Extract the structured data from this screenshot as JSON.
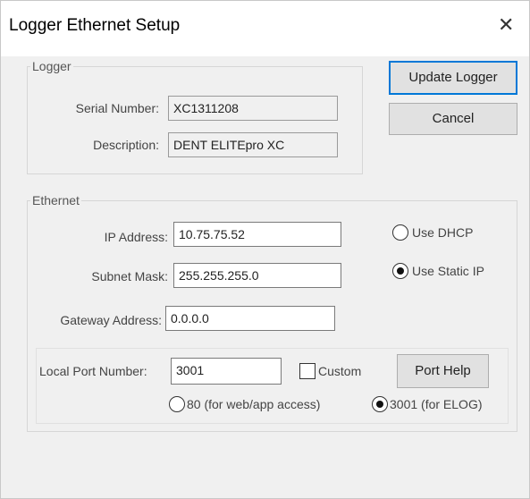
{
  "window": {
    "title": "Logger Ethernet Setup",
    "close_glyph": "✕"
  },
  "logger": {
    "group_label": "Logger",
    "serial_label": "Serial Number:",
    "serial_value": "XC1311208",
    "description_label": "Description:",
    "description_value": "DENT ELITEpro XC"
  },
  "buttons": {
    "update": "Update Logger",
    "cancel": "Cancel",
    "port_help": "Port Help"
  },
  "ethernet": {
    "group_label": "Ethernet",
    "ip_label": "IP Address:",
    "ip_value": "10.75.75.52",
    "subnet_label": "Subnet Mask:",
    "subnet_value": "255.255.255.0",
    "gateway_label": "Gateway Address:",
    "gateway_value": "0.0.0.0",
    "dhcp_label": "Use DHCP",
    "static_label": "Use Static IP",
    "selected_mode": "Use Static IP"
  },
  "port": {
    "label": "Local Port Number:",
    "value": "3001",
    "custom_label": "Custom",
    "custom_checked": false,
    "option_80": "80 (for web/app access)",
    "option_3001": "3001 (for ELOG)",
    "selected_option": "3001 (for ELOG)"
  }
}
